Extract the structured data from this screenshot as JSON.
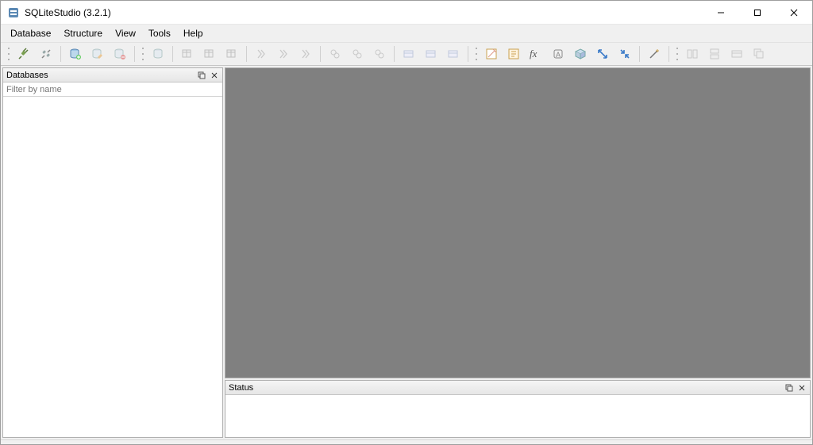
{
  "title": "SQLiteStudio (3.2.1)",
  "menus": {
    "database": "Database",
    "structure": "Structure",
    "view": "View",
    "tools": "Tools",
    "help": "Help"
  },
  "toolbar": {
    "connect": "connect",
    "disconnect": "disconnect",
    "add_db": "add-database",
    "edit_db": "edit-database",
    "remove_db": "remove-database",
    "new_table": "new-table",
    "edit_table": "edit-table",
    "del_table": "delete-table",
    "new_index": "new-index",
    "edit_index": "edit-index",
    "del_index": "delete-index",
    "new_trigger": "new-trigger",
    "edit_trigger": "edit-trigger",
    "del_trigger": "delete-trigger",
    "new_view": "new-view",
    "edit_view": "edit-view",
    "del_view": "delete-view",
    "sql_editor": "open-sql-editor",
    "sql_history": "sql-functions-editor",
    "fx": "custom-sql-functions",
    "collations": "collations-editor",
    "extensions": "extension-manager",
    "import": "import",
    "export": "export",
    "config": "configuration",
    "tile_h": "tile-horizontal",
    "tile_v": "tile-vertical",
    "cascade": "cascade",
    "close_all": "close-all"
  },
  "panels": {
    "databases_title": "Databases",
    "filter_placeholder": "Filter by name",
    "status_title": "Status"
  }
}
